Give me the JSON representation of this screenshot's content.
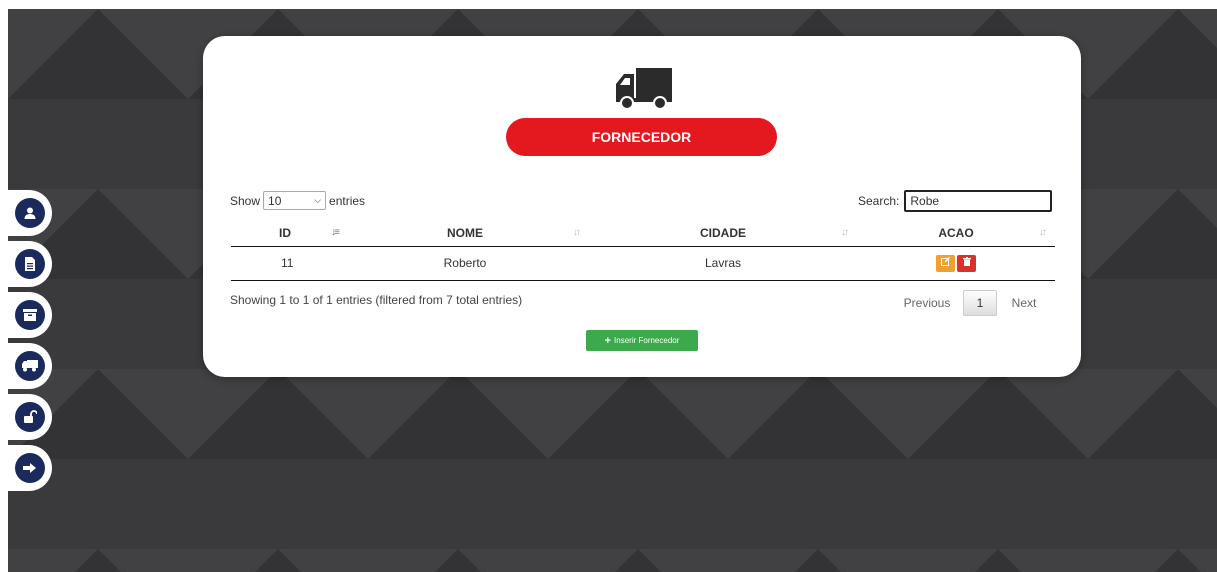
{
  "page": {
    "title": "FORNECEDOR",
    "truck_icon": "truck-icon",
    "accent_color": "#e3191f"
  },
  "sidebar": {
    "items": [
      {
        "icon": "user-icon"
      },
      {
        "icon": "document-icon"
      },
      {
        "icon": "archive-icon"
      },
      {
        "icon": "truck-icon"
      },
      {
        "icon": "unlock-icon"
      },
      {
        "icon": "logout-icon"
      }
    ]
  },
  "table_controls": {
    "show_label": "Show",
    "page_size": "10",
    "entries_label": "entries",
    "search_label": "Search:",
    "search_value": "Robe"
  },
  "table": {
    "headers": [
      "ID",
      "NOME",
      "CIDADE",
      "ACAO"
    ],
    "rows": [
      {
        "id": "11",
        "nome": "Roberto",
        "cidade": "Lavras"
      }
    ]
  },
  "footer": {
    "info": "Showing 1 to 1 of 1 entries (filtered from 7 total entries)",
    "previous": "Previous",
    "page": "1",
    "next": "Next"
  },
  "actions": {
    "add_label": "Inserir Fornecedor"
  }
}
